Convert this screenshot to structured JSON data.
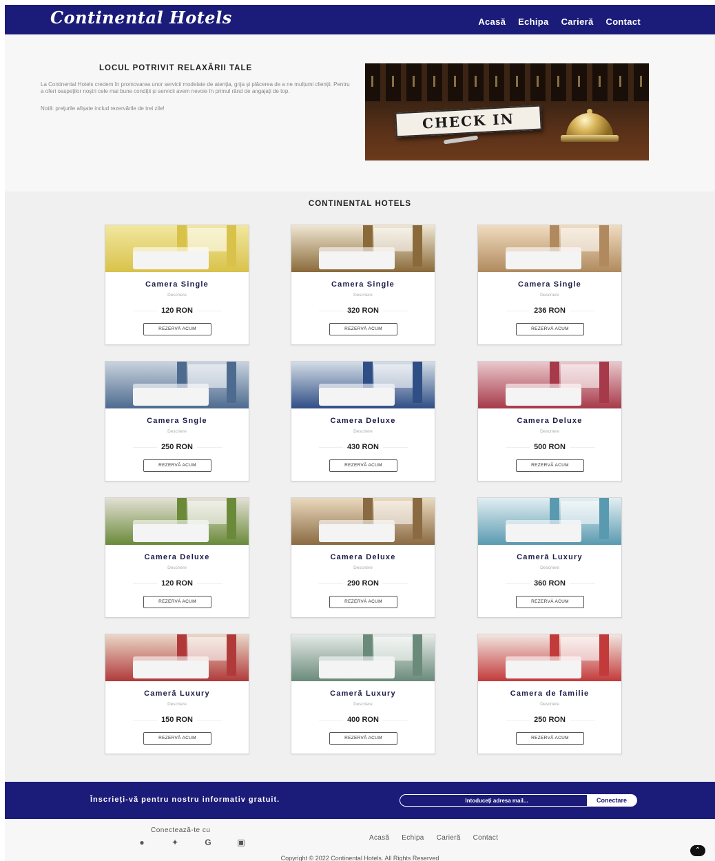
{
  "brand": "Continental Hotels",
  "nav": [
    "Acasă",
    "Echipa",
    "Carieră",
    "Contact"
  ],
  "hero": {
    "title": "LOCUL POTRIVIT RELAXĂRII TALE",
    "text": "La Continental Hotels credem în promovarea unor servicii modelate de atenția, grija și plăcerea de a ne mulțumi clienții. Pentru a oferi oaspeților noștri cele mai bune condiții și servicii avem nevoie în primul rând de angajați de top.",
    "note": "Notă: prețurile afișate includ rezervările de trei zile!",
    "image_sign": "CHECK IN"
  },
  "section_title": "CONTINENTAL HOTELS",
  "rooms": [
    {
      "title": "Camera Single",
      "desc": "Descriere",
      "price": "120 RON",
      "button": "REZERVĂ ACUM",
      "palette": [
        "#d9c24a",
        "#f1e7a0"
      ]
    },
    {
      "title": "Camera Single",
      "desc": "Descriere",
      "price": "320 RON",
      "button": "REZERVĂ ACUM",
      "palette": [
        "#8a6a3a",
        "#efe6d2"
      ]
    },
    {
      "title": "Camera Single",
      "desc": "Descriere",
      "price": "236 RON",
      "button": "REZERVĂ ACUM",
      "palette": [
        "#b08a5e",
        "#f0dcc0"
      ]
    },
    {
      "title": "Camera Sngle",
      "desc": "Descriere",
      "price": "250 RON",
      "button": "REZERVĂ ACUM",
      "palette": [
        "#4d6b8f",
        "#c9d3de"
      ]
    },
    {
      "title": "Camera Deluxe",
      "desc": "Descriere",
      "price": "430 RON",
      "button": "REZERVĂ ACUM",
      "palette": [
        "#2f4e86",
        "#d4dde6"
      ]
    },
    {
      "title": "Camera Deluxe",
      "desc": "Descriere",
      "price": "500 RON",
      "button": "REZERVĂ ACUM",
      "palette": [
        "#a63a4a",
        "#eac8cc"
      ]
    },
    {
      "title": "Camera Deluxe",
      "desc": "Descriere",
      "price": "120 RON",
      "button": "REZERVĂ ACUM",
      "palette": [
        "#6a8a3a",
        "#e3e0d4"
      ]
    },
    {
      "title": "Camera Deluxe",
      "desc": "Descriere",
      "price": "290 RON",
      "button": "REZERVĂ ACUM",
      "palette": [
        "#8a6a42",
        "#ead9be"
      ]
    },
    {
      "title": "Cameră Luxury",
      "desc": "Descriere",
      "price": "360 RON",
      "button": "REZERVĂ ACUM",
      "palette": [
        "#5a9ab0",
        "#e2eef2"
      ]
    },
    {
      "title": "Cameră Luxury",
      "desc": "Descriere",
      "price": "150 RON",
      "button": "REZERVĂ ACUM",
      "palette": [
        "#b03a3a",
        "#ead7c8"
      ]
    },
    {
      "title": "Cameră Luxury",
      "desc": "Descriere",
      "price": "400 RON",
      "button": "REZERVĂ ACUM",
      "palette": [
        "#6a8a7a",
        "#e6ebe8"
      ]
    },
    {
      "title": "Camera de familie",
      "desc": "Descriere",
      "price": "250 RON",
      "button": "REZERVĂ ACUM",
      "palette": [
        "#c23a3a",
        "#f2e6e0"
      ]
    }
  ],
  "newsletter": {
    "text": "Înscrieți-vă pentru nostru informativ gratuit.",
    "placeholder": "Intoduceți adresa mail...",
    "button": "Conectare"
  },
  "footer": {
    "connect": "Conectează-te cu",
    "socials": [
      "facebook-icon",
      "twitter-icon",
      "google-icon",
      "instagram-icon"
    ],
    "nav": [
      "Acasă",
      "Echipa",
      "Carieră",
      "Contact"
    ],
    "copyright": "Copyright © 2022 Continental Hotels. All Rights Reserved"
  }
}
